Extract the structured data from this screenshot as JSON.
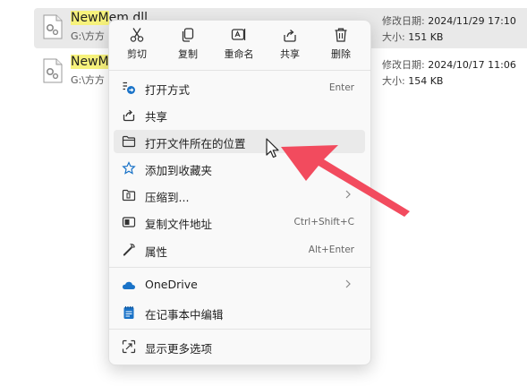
{
  "files": [
    {
      "name_highlight": "NewM",
      "name_rest": "em.dll",
      "path": "G:\\方方",
      "modified_label": "修改日期:",
      "modified_value": "2024/11/29 17:10",
      "size_label": "大小:",
      "size_value": "151 KB"
    },
    {
      "name_highlight": "NewM",
      "name_rest": "",
      "path": "G:\\方方",
      "modified_label": "修改日期:",
      "modified_value": "2024/10/17 11:06",
      "size_label": "大小:",
      "size_value": "154 KB"
    }
  ],
  "context_menu": {
    "quick_actions": [
      {
        "label": "剪切",
        "icon": "scissors-icon"
      },
      {
        "label": "复制",
        "icon": "copy-icon"
      },
      {
        "label": "重命名",
        "icon": "rename-icon"
      },
      {
        "label": "共享",
        "icon": "share-icon"
      },
      {
        "label": "删除",
        "icon": "trash-icon"
      }
    ],
    "items": [
      {
        "label": "打开方式",
        "shortcut": "Enter",
        "icon": "open-with-icon"
      },
      {
        "label": "共享",
        "shortcut": "",
        "icon": "share-icon"
      },
      {
        "label": "打开文件所在的位置",
        "shortcut": "",
        "icon": "folder-icon"
      },
      {
        "label": "添加到收藏夹",
        "shortcut": "",
        "icon": "star-icon"
      },
      {
        "label": "压缩到...",
        "shortcut": "",
        "icon": "zip-icon"
      },
      {
        "label": "复制文件地址",
        "shortcut": "Ctrl+Shift+C",
        "icon": "copy-path-icon"
      },
      {
        "label": "属性",
        "shortcut": "Alt+Enter",
        "icon": "wrench-icon"
      },
      {
        "label": "OneDrive",
        "shortcut": "",
        "icon": "cloud-icon"
      },
      {
        "label": "在记事本中编辑",
        "shortcut": "",
        "icon": "notepad-icon"
      },
      {
        "label": "显示更多选项",
        "shortcut": "",
        "icon": "more-options-icon"
      }
    ]
  },
  "colors": {
    "accent_blue": "#1a73c8",
    "highlight_yellow": "#f7f27c",
    "annotation_arrow": "#f24b5e",
    "selected_row": "#e9e9e9"
  }
}
